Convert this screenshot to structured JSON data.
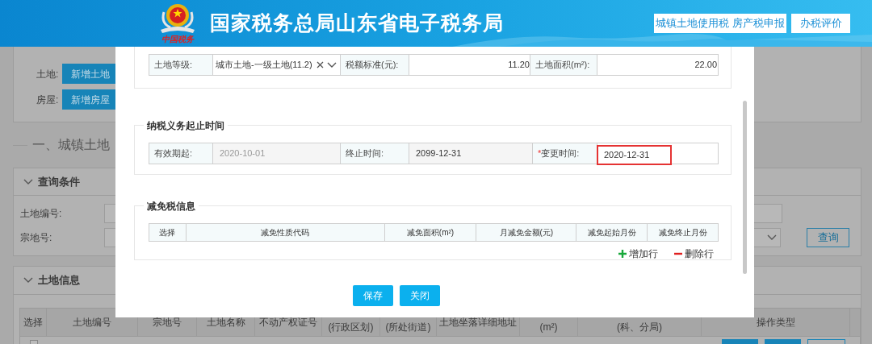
{
  "header": {
    "title": "国家税务总局山东省电子税务局",
    "logo_text": "中国税务",
    "buttons": [
      "城镇土地使用税 房产税申报",
      "办税评价"
    ]
  },
  "background_page": {
    "add_rows": [
      {
        "label": "土地:",
        "button": "新增土地"
      },
      {
        "label": "房屋:",
        "button": "新增房屋"
      }
    ],
    "section_heading": "一、城镇土地",
    "query_panel": {
      "title": "查询条件",
      "expanded": true,
      "fields": [
        "土地编号:",
        "宗地号:"
      ],
      "search_button": "查询"
    },
    "land_info_panel": {
      "title": "土地信息",
      "expanded": true,
      "rows": [
        {
          "checked": false
        }
      ],
      "columns": [
        "选择",
        "土地编号",
        "宗地号",
        "土地名称",
        "不动产权证号",
        "(行政区划)",
        "(所处街道)",
        "土地坐落详细地址",
        "(m²)",
        "(科、分局)",
        "操作类型"
      ]
    }
  },
  "modal": {
    "land_row": {
      "grade_label": "土地等级:",
      "grade_value": "城市土地-一级土地(11.2)",
      "rate_label": "税额标准(元):",
      "rate_value": "11.20",
      "area_label": "土地面积(m²):",
      "area_value": "22.00"
    },
    "period_section": {
      "title": "纳税义务起止时间",
      "fields": [
        {
          "label": "有效期起:",
          "value": "2020-10-01",
          "readonly": true,
          "disabled": true,
          "highlighted": false
        },
        {
          "label": "终止时间:",
          "value": "2099-12-31",
          "readonly": true,
          "disabled": false,
          "highlighted": false
        },
        {
          "label": "变更时间:",
          "required_mark": "*",
          "value": "2020-12-31",
          "readonly": false,
          "disabled": false,
          "highlighted": true
        }
      ]
    },
    "relief_section": {
      "title": "减免税信息",
      "columns": [
        "选择",
        "减免性质代码",
        "减免面积(m²)",
        "月减免金额(元)",
        "减免起始月份",
        "减免终止月份"
      ],
      "add_label": "增加行",
      "remove_label": "删除行"
    },
    "buttons": [
      "保存",
      "关闭"
    ]
  }
}
